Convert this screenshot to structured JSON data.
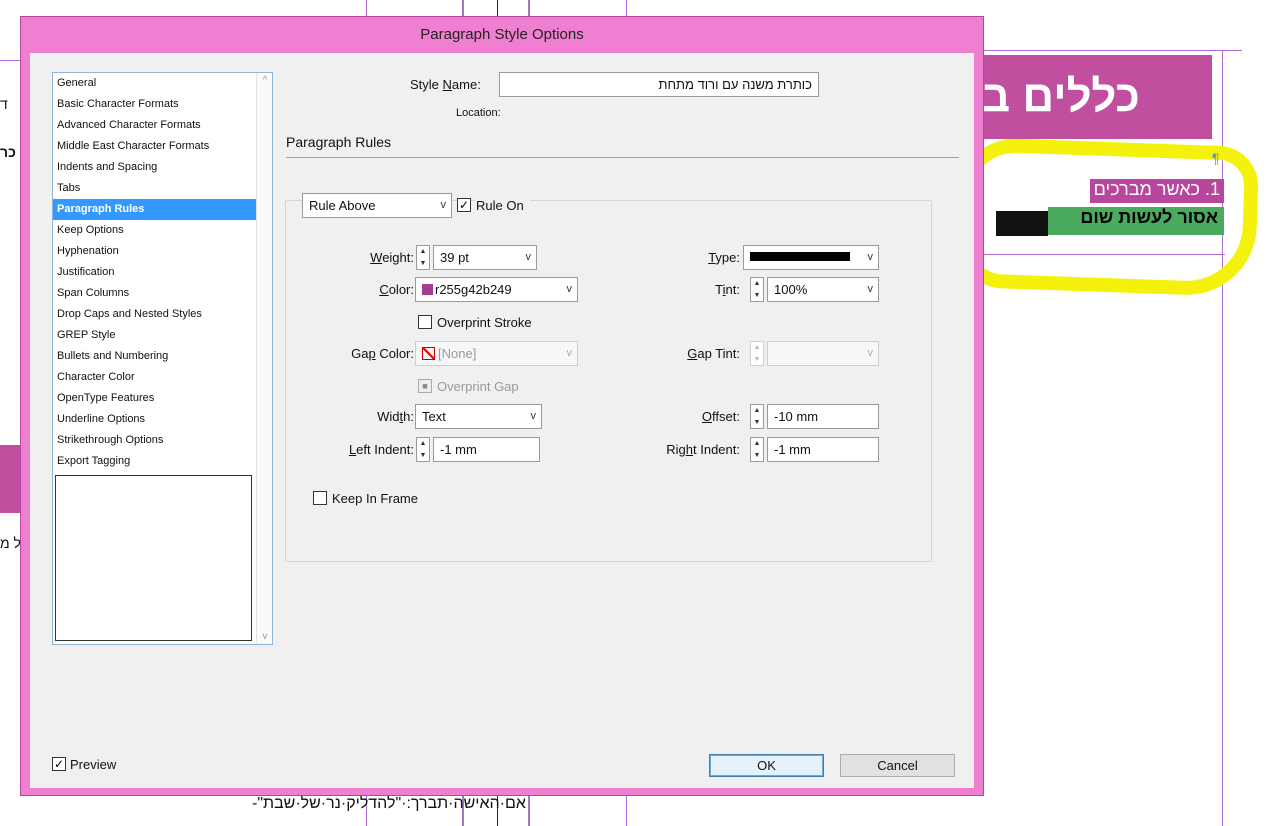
{
  "background": {
    "heading": "כללים ב",
    "item1": "1. כאשר מברכים",
    "item2": "אסור לעשות שום",
    "pilcrow": "¶",
    "left_fragment_1": "ד",
    "left_fragment_2": "כר",
    "left_fragment_3": "ל מ",
    "bottom_text": "אם·האישה·תברך:·\"להדליק·נר·של·שבת\"-"
  },
  "dialog": {
    "title": "Paragraph Style Options",
    "categories": [
      "General",
      "Basic Character Formats",
      "Advanced Character Formats",
      "Middle East Character Formats",
      "Indents and Spacing",
      "Tabs",
      "Paragraph Rules",
      "Keep Options",
      "Hyphenation",
      "Justification",
      "Span Columns",
      "Drop Caps and Nested Styles",
      "GREP Style",
      "Bullets and Numbering",
      "Character Color",
      "OpenType Features",
      "Underline Options",
      "Strikethrough Options",
      "Export Tagging"
    ],
    "selected_category": "Paragraph Rules",
    "style_name_label_pre": "Style ",
    "style_name_label_u": "N",
    "style_name_label_post": "ame:",
    "style_name_value": "כותרת משנה עם ורוד מתחת",
    "location_label": "Location:",
    "section_title": "Paragraph Rules",
    "rule_select": "Rule Above",
    "rule_on_label": "Rule On",
    "rule_on_checked": true,
    "weight": {
      "label_u": "W",
      "label_rest": "eight:",
      "value": "39 pt"
    },
    "type": {
      "label_u": "T",
      "label_rest": "ype:"
    },
    "color": {
      "label_pre": "",
      "label_u": "C",
      "label_rest": "olor:",
      "value": "r255g42b249",
      "swatch": "#a63c92"
    },
    "tint": {
      "label_pre": "T",
      "label_u": "i",
      "label_rest": "nt:",
      "value": "100%"
    },
    "overprint_stroke_label": "Overprint Stroke",
    "gap_color": {
      "label_pre": "Ga",
      "label_u": "p",
      "label_rest": " Color:",
      "value": "[None]"
    },
    "gap_tint": {
      "label_u": "G",
      "label_rest": "ap Tint:",
      "value": ""
    },
    "overprint_gap_label": "Overprint Gap",
    "width": {
      "label_pre": "Wid",
      "label_u": "t",
      "label_rest": "h:",
      "value": "Text"
    },
    "offset": {
      "label_u": "O",
      "label_rest": "ffset:",
      "value": "-10 mm"
    },
    "left_indent": {
      "label_u": "L",
      "label_rest": "eft Indent:",
      "value": "-1 mm"
    },
    "right_indent": {
      "label_pre": "Rig",
      "label_u": "h",
      "label_rest": "t Indent:",
      "value": "-1 mm"
    },
    "keep_in_frame_label": "Keep In Frame",
    "preview_label": "Preview",
    "preview_checked": true,
    "ok_label": "OK",
    "cancel_label": "Cancel",
    "colors": {
      "frame": "#ef7fd0",
      "selection": "#3399ff",
      "heading_bg": "#c0509f",
      "highlight": "#f4f20c"
    }
  }
}
